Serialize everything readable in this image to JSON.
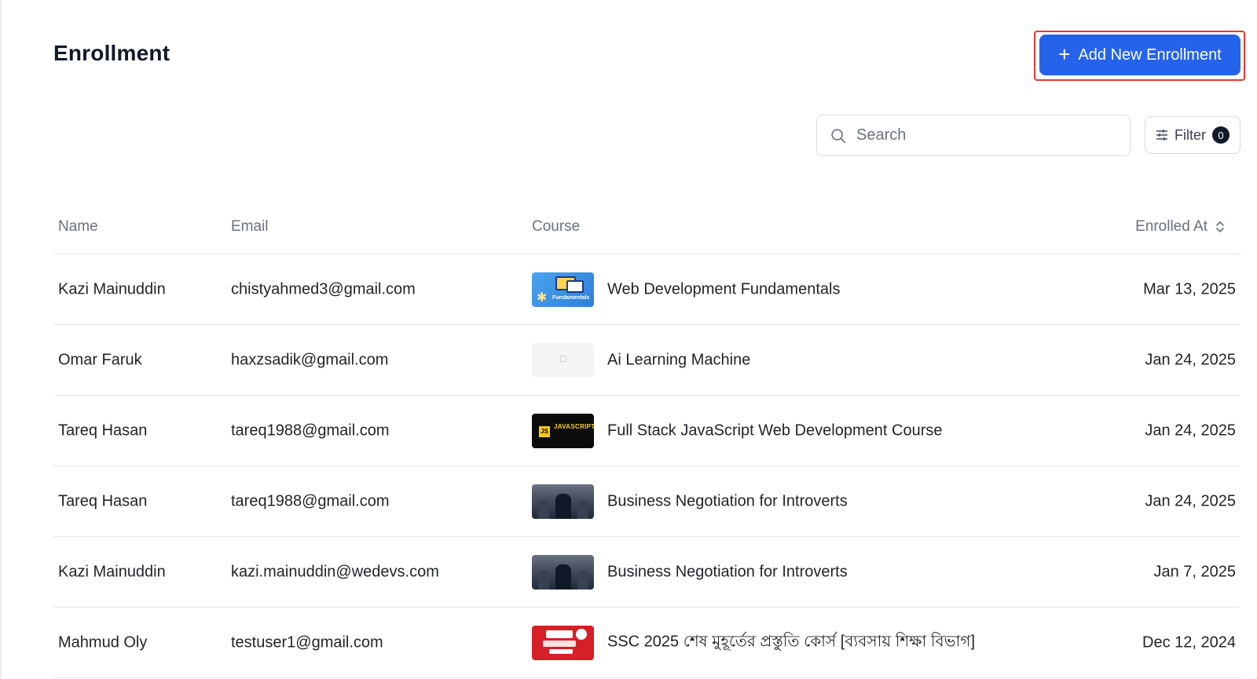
{
  "page": {
    "title": "Enrollment",
    "add_button_label": "Add New Enrollment",
    "add_button_icon": "plus-icon",
    "accent_color": "#2563eb"
  },
  "search": {
    "placeholder": "Search",
    "value": "",
    "icon": "search-icon"
  },
  "filter": {
    "label": "Filter",
    "count": "0",
    "icon": "sliders-icon"
  },
  "table": {
    "columns": {
      "name": "Name",
      "email": "Email",
      "course": "Course",
      "enrolled_at": "Enrolled At"
    },
    "rows": [
      {
        "name": "Kazi Mainuddin",
        "email": "chistyahmed3@gmail.com",
        "course": "Web Development Fundamentals",
        "thumbnail": "web-dev-thumbnail",
        "enrolled_at": "Mar 13, 2025"
      },
      {
        "name": "Omar Faruk",
        "email": "haxzsadik@gmail.com",
        "course": "Ai Learning Machine",
        "thumbnail": "ai-thumbnail",
        "enrolled_at": "Jan 24, 2025"
      },
      {
        "name": "Tareq Hasan",
        "email": "tareq1988@gmail.com",
        "course": "Full Stack JavaScript Web Development Course",
        "thumbnail": "javascript-thumbnail",
        "enrolled_at": "Jan 24, 2025"
      },
      {
        "name": "Tareq Hasan",
        "email": "tareq1988@gmail.com",
        "course": "Business Negotiation for Introverts",
        "thumbnail": "business-thumbnail",
        "enrolled_at": "Jan 24, 2025"
      },
      {
        "name": "Kazi Mainuddin",
        "email": "kazi.mainuddin@wedevs.com",
        "course": "Business Negotiation for Introverts",
        "thumbnail": "business-thumbnail",
        "enrolled_at": "Jan 7, 2025"
      },
      {
        "name": "Mahmud Oly",
        "email": "testuser1@gmail.com",
        "course": "SSC 2025 শেষ মুহূর্তের প্রস্তুতি কোর্স [ব্যবসায় শিক্ষা বিভাগ]",
        "thumbnail": "ssc-thumbnail",
        "enrolled_at": "Dec 12, 2024"
      }
    ]
  },
  "thumbnail_text": {
    "web": "Fundamentals",
    "js_badge": "JS",
    "js_title": "JAVASCRIPT"
  }
}
